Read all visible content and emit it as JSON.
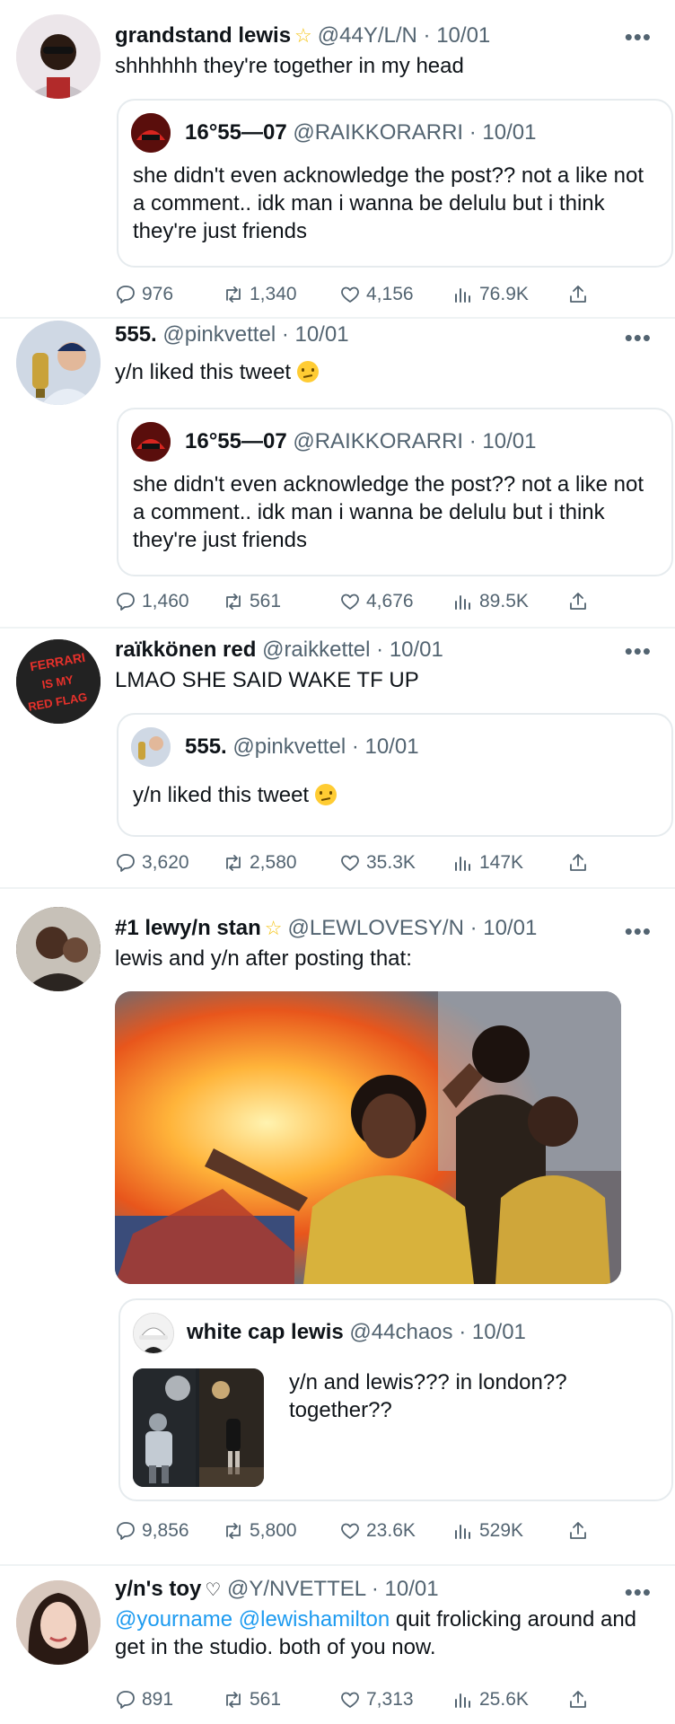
{
  "tweets": [
    {
      "name": "grandstand lewis",
      "handle": "@44Y/L/N",
      "date": "· 10/01",
      "text": "shhhhhh they're together in my head",
      "quote": {
        "name": "16°55—07",
        "handle": "@RAIKKORARRI",
        "date": "· 10/01",
        "text": "she didn't even acknowledge the post?? not a like not a comment.. idk man i wanna be delulu but i think they're just friends"
      },
      "replies": "976",
      "retweets": "1,340",
      "likes": "4,156",
      "views": "76.9K"
    },
    {
      "name": "555.",
      "handle": "@pinkvettel",
      "date": "· 10/01",
      "text": "y/n liked this tweet",
      "quote": {
        "name": "16°55—07",
        "handle": "@RAIKKORARRI",
        "date": "· 10/01",
        "text": "she didn't even acknowledge the post?? not a like not a comment.. idk man i wanna be delulu but i think they're just friends"
      },
      "replies": "1,460",
      "retweets": "561",
      "likes": "4,676",
      "views": "89.5K"
    },
    {
      "name": "raïkkönen red",
      "handle": "@raikkettel",
      "date": "· 10/01",
      "text": "LMAO SHE SAID WAKE TF UP",
      "avatar_text": [
        "FERRARI",
        "IS MY",
        "RED FLAG"
      ],
      "quote": {
        "name": "555.",
        "handle": "@pinkvettel",
        "date": "· 10/01",
        "text": "y/n liked this tweet"
      },
      "replies": "3,620",
      "retweets": "2,580",
      "likes": "35.3K",
      "views": "147K"
    },
    {
      "name": "#1 lewy/n stan",
      "handle": "@LEWLOVESY/N",
      "date": "· 10/01",
      "text": "lewis and y/n after posting that:",
      "quote": {
        "name": "white cap lewis",
        "handle": "@44chaos",
        "date": "· 10/01",
        "text": "y/n and lewis??? in london?? together??"
      },
      "replies": "9,856",
      "retweets": "5,800",
      "likes": "23.6K",
      "views": "529K"
    },
    {
      "name": "y/n's toy",
      "handle": "@Y/NVETTEL",
      "date": "· 10/01",
      "mention1": "@yourname",
      "mention2": "@lewishamilton",
      "text": " quit frolicking around and get in the studio. both of you now.",
      "replies": "891",
      "retweets": "561",
      "likes": "7,313",
      "views": "25.6K"
    }
  ],
  "more_glyph": "•••",
  "colors": {
    "accent": "#1d9bf0",
    "muted": "#536471",
    "border": "#e6ebee"
  }
}
